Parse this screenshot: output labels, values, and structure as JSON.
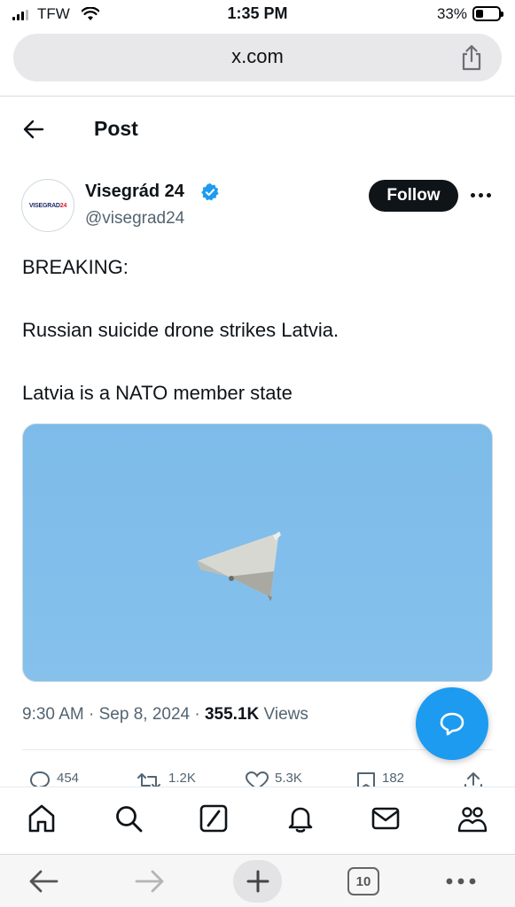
{
  "status_bar": {
    "carrier": "TFW",
    "time": "1:35 PM",
    "battery_percent": "33%",
    "battery_level": 0.33,
    "icons": [
      "signal-icon",
      "wifi-icon",
      "battery-icon"
    ]
  },
  "browser": {
    "url": "x.com",
    "icons": [
      "share-icon",
      "back-arrow-icon",
      "forward-arrow-icon",
      "plus-icon",
      "more-icon"
    ],
    "tab_count": "10"
  },
  "header": {
    "title": "Post",
    "back_icon": "back-arrow-icon"
  },
  "author": {
    "name": "Visegrád 24",
    "handle": "@visegrad24",
    "avatar_text_main": "VISEGRAD",
    "avatar_text_accent": "24",
    "verified": true,
    "follow_label": "Follow"
  },
  "tweet": {
    "lines": [
      "BREAKING:",
      "Russian suicide drone strikes Latvia.",
      "Latvia is a NATO member state"
    ],
    "media": {
      "type": "photo",
      "sky_color": "#7fbcea"
    }
  },
  "meta": {
    "time": "9:30 AM",
    "separator": "·",
    "date": "Sep 8, 2024",
    "views_count": "355.1K",
    "views_label": "Views"
  },
  "actions": {
    "replies": "454",
    "reposts": "1.2K",
    "likes": "5.3K",
    "bookmarks": "182"
  },
  "tabs": [
    "home-icon",
    "search-icon",
    "grok-icon",
    "notifications-icon",
    "messages-icon",
    "communities-icon"
  ],
  "colors": {
    "accent": "#1d9bf0",
    "text": "#0f1419",
    "secondary": "#536471"
  }
}
